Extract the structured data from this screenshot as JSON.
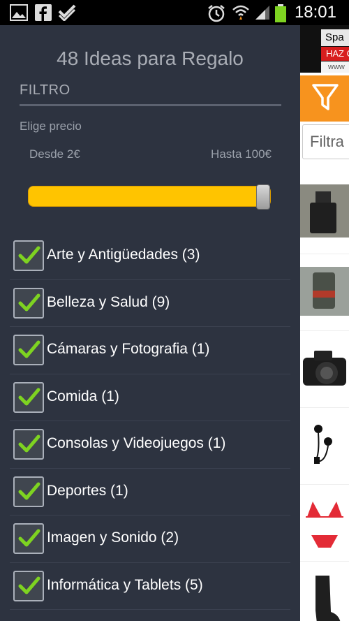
{
  "status_bar": {
    "time": "18:01",
    "icons": [
      "picture-icon",
      "facebook-icon",
      "checkmark-app-icon",
      "alarm-icon",
      "wifi-icon",
      "signal-icon",
      "battery-icon"
    ]
  },
  "drawer": {
    "title": "48 Ideas para Regalo",
    "section_header": "FILTRO",
    "price_label": "Elige precio",
    "price_from": "Desde 2€",
    "price_to": "Hasta 100€",
    "slider_fill_fraction": 1.0,
    "accent_color": "#ffc400",
    "categories": [
      {
        "label": "Arte y Antigüedades (3)",
        "checked": true
      },
      {
        "label": "Belleza y Salud (9)",
        "checked": true
      },
      {
        "label": "Cámaras y Fotografia (1)",
        "checked": true
      },
      {
        "label": "Comida (1)",
        "checked": true
      },
      {
        "label": "Consolas y Videojuegos (1)",
        "checked": true
      },
      {
        "label": "Deportes (1)",
        "checked": true
      },
      {
        "label": "Imagen y Sonido (2)",
        "checked": true
      },
      {
        "label": "Informática y Tablets (5)",
        "checked": true
      }
    ]
  },
  "content": {
    "ad": {
      "line1": "Spa",
      "line2": "HAZ C",
      "line3": "www"
    },
    "filter_button_color": "#f7931e",
    "filter_placeholder": "Filtra",
    "products": [
      "perfume-bottle",
      "candle-jar",
      "dslr-camera",
      "earphones",
      "red-bikini",
      "black-boot"
    ]
  }
}
